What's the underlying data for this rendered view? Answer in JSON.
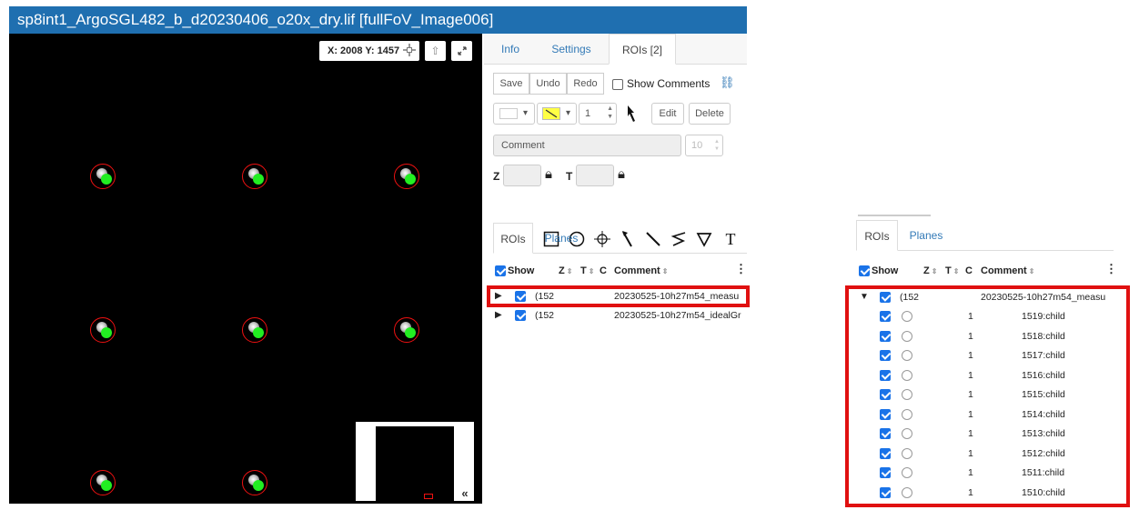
{
  "window": {
    "title": "sp8int1_ArgoSGL482_b_d20230406_o20x_dry.lif [fullFoV_Image006]"
  },
  "viewer": {
    "coords": "X: 2008 Y: 1457",
    "collapse_label": "«"
  },
  "panel": {
    "tabs": [
      "Info",
      "Settings",
      "ROIs [2]"
    ],
    "toolbar": {
      "save": "Save",
      "undo": "Undo",
      "redo": "Redo",
      "show_comments": "Show Comments"
    },
    "style": {
      "caret1": "▾",
      "caret2": "▾",
      "stroke_width": "1",
      "edit": "Edit",
      "delete": "Delete"
    },
    "comment": {
      "placeholder": "Comment",
      "font_size": "10"
    },
    "zt": {
      "z_label": "Z",
      "t_label": "T"
    },
    "subtabs": [
      "ROIs",
      "Planes"
    ],
    "columns": {
      "show": "Show",
      "z": "Z",
      "t": "T",
      "c": "C",
      "comment": "Comment"
    },
    "rows": [
      {
        "id": "(152",
        "comment": "20230525-10h27m54_measu"
      },
      {
        "id": "(152",
        "comment": "20230525-10h27m54_idealGr"
      }
    ]
  },
  "zoomed": {
    "subtabs": [
      "ROIs",
      "Planes"
    ],
    "columns": {
      "show": "Show",
      "z": "Z",
      "t": "T",
      "c": "C",
      "comment": "Comment"
    },
    "parent": {
      "id": "(152",
      "comment": "20230525-10h27m54_measu"
    },
    "children": [
      {
        "t": "1",
        "comment": "1519:child"
      },
      {
        "t": "1",
        "comment": "1518:child"
      },
      {
        "t": "1",
        "comment": "1517:child"
      },
      {
        "t": "1",
        "comment": "1516:child"
      },
      {
        "t": "1",
        "comment": "1515:child"
      },
      {
        "t": "1",
        "comment": "1514:child"
      },
      {
        "t": "1",
        "comment": "1513:child"
      },
      {
        "t": "1",
        "comment": "1512:child"
      },
      {
        "t": "1",
        "comment": "1511:child"
      },
      {
        "t": "1",
        "comment": "1510:child"
      }
    ]
  },
  "colors": {
    "title_bar": "#1f6fb0",
    "highlight": "#e01010",
    "roi_fill": "#22ee22",
    "checkbox": "#1a73e8",
    "link": "#337ab7"
  },
  "icons": [
    "crosshair-icon",
    "upload-icon",
    "fullscreen-icon",
    "link-icon",
    "pointer-tool-icon",
    "rectangle-tool-icon",
    "ellipse-tool-icon",
    "point-tool-icon",
    "arrow-tool-icon",
    "line-tool-icon",
    "polyline-tool-icon",
    "polygon-tool-icon",
    "text-tool-icon",
    "lock-icon",
    "columns-menu-icon"
  ]
}
